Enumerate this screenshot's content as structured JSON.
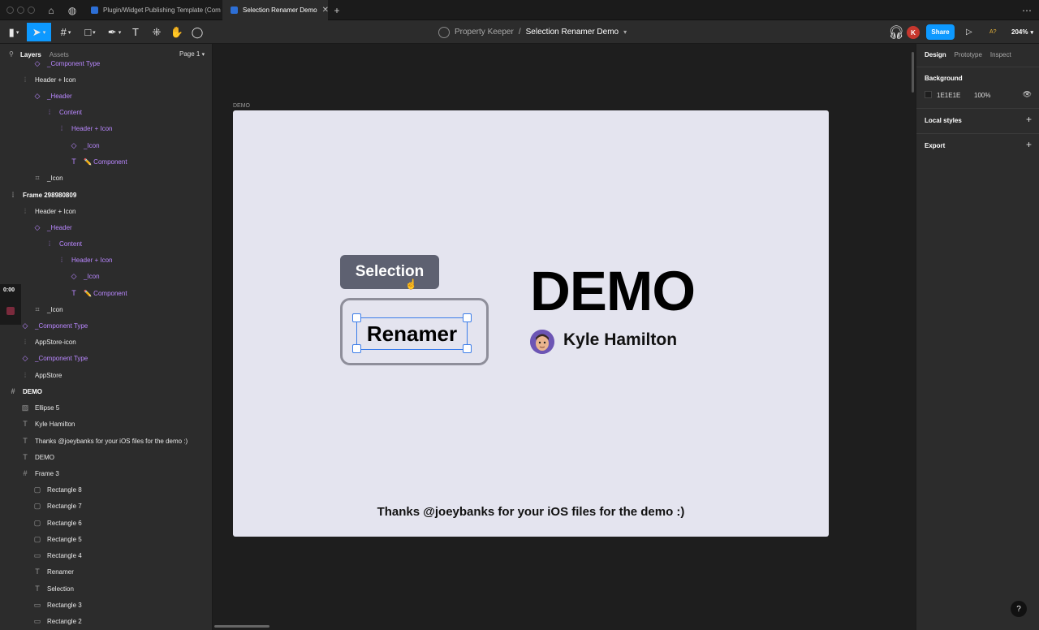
{
  "tabs": [
    {
      "label": "Plugin/Widget Publishing Template (Com"
    },
    {
      "label": "Selection Renamer Demo"
    }
  ],
  "toolbar": {
    "project": "Property Keeper",
    "file": "Selection Renamer Demo",
    "share": "Share",
    "user_initial": "K",
    "zoom": "204%",
    "font_indicator": "A?"
  },
  "left_panel": {
    "tab_layers": "Layers",
    "tab_assets": "Assets",
    "page": "Page 1",
    "layers": [
      {
        "label": "_Component Type",
        "icon": "diamond-icon"
      },
      {
        "label": "Header + Icon",
        "icon": "autolayout-icon"
      },
      {
        "label": "_Header",
        "icon": "diamond-icon"
      },
      {
        "label": "Content",
        "icon": "autolayout-icon"
      },
      {
        "label": "Header + Icon",
        "icon": "autolayout-icon"
      },
      {
        "label": "_Icon",
        "icon": "diamond-icon"
      },
      {
        "label": "✏️ Component",
        "icon": "text-icon"
      },
      {
        "label": "_Icon",
        "icon": "frame-icon"
      },
      {
        "label": "Frame 298980809",
        "icon": "autolayout-icon"
      },
      {
        "label": "Header + Icon",
        "icon": "autolayout-icon"
      },
      {
        "label": "_Header",
        "icon": "diamond-icon"
      },
      {
        "label": "Content",
        "icon": "autolayout-icon"
      },
      {
        "label": "Header + Icon",
        "icon": "autolayout-icon"
      },
      {
        "label": "_Icon",
        "icon": "diamond-icon"
      },
      {
        "label": "✏️ Component",
        "icon": "text-icon"
      },
      {
        "label": "_Icon",
        "icon": "frame-icon"
      },
      {
        "label": "_Component Type",
        "icon": "diamond-icon"
      },
      {
        "label": "AppStore-icon",
        "icon": "autolayout-icon"
      },
      {
        "label": "_Component Type",
        "icon": "diamond-icon"
      },
      {
        "label": "AppStore",
        "icon": "autolayout-icon"
      },
      {
        "label": "DEMO",
        "icon": "frame-hash-icon"
      },
      {
        "label": "Ellipse 5",
        "icon": "image-icon"
      },
      {
        "label": "Kyle Hamilton",
        "icon": "text-icon"
      },
      {
        "label": "Thanks @joeybanks for your iOS files for the demo :)",
        "icon": "text-icon"
      },
      {
        "label": "DEMO",
        "icon": "text-icon"
      },
      {
        "label": "Frame 3",
        "icon": "frame-hash-icon"
      },
      {
        "label": "Rectangle 8",
        "icon": "rect-icon"
      },
      {
        "label": "Rectangle 7",
        "icon": "rect-icon"
      },
      {
        "label": "Rectangle 6",
        "icon": "rect-icon"
      },
      {
        "label": "Rectangle 5",
        "icon": "rect-icon"
      },
      {
        "label": "Rectangle 4",
        "icon": "line-icon"
      },
      {
        "label": "Renamer",
        "icon": "text-icon"
      },
      {
        "label": "Selection",
        "icon": "text-icon"
      },
      {
        "label": "Rectangle 3",
        "icon": "line-icon"
      },
      {
        "label": "Rectangle 2",
        "icon": "line-icon"
      }
    ]
  },
  "canvas": {
    "frame_label": "DEMO",
    "selection_text": "Selection",
    "renamer_text": "Renamer",
    "demo_title": "DEMO",
    "author": "Kyle Hamilton",
    "thanks": "Thanks @joeybanks for your iOS files for the demo :)",
    "background": "#E4E4EF"
  },
  "right_panel": {
    "tab_design": "Design",
    "tab_prototype": "Prototype",
    "tab_inspect": "Inspect",
    "background_label": "Background",
    "background_hex": "1E1E1E",
    "background_opacity": "100%",
    "local_styles": "Local styles",
    "export": "Export"
  },
  "recording": {
    "time": "0:00"
  },
  "colors": {
    "accent": "#0D99FF",
    "component": "#B987FF",
    "avatar": "#C7372E"
  }
}
